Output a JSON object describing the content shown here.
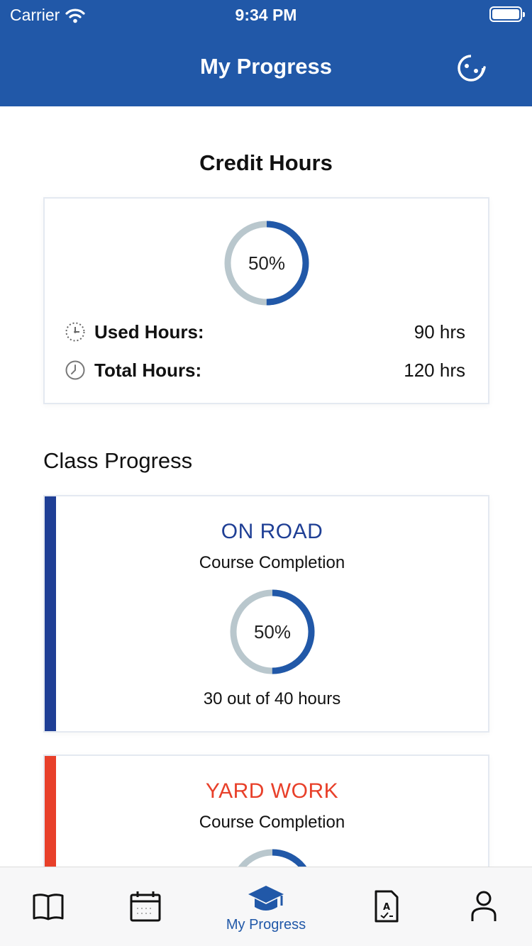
{
  "status_bar": {
    "carrier": "Carrier",
    "time": "9:34 PM"
  },
  "header": {
    "title": "My Progress",
    "help_icon": "support-icon"
  },
  "credit_hours": {
    "title": "Credit Hours",
    "percent_label": "50%",
    "percent": 0.5,
    "used_label": "Used Hours:",
    "used_value": "90 hrs",
    "total_label": "Total Hours:",
    "total_value": "120 hrs"
  },
  "class_progress": {
    "title": "Class Progress",
    "classes": [
      {
        "name": "ON ROAD",
        "subtitle": "Course Completion",
        "percent_label": "50%",
        "percent": 0.5,
        "hours": "30 out of 40 hours",
        "color": "#1f3f95"
      },
      {
        "name": "YARD WORK",
        "subtitle": "Course Completion",
        "percent": 0.5,
        "color": "#e8402a"
      }
    ]
  },
  "tabbar": {
    "tabs": [
      {
        "icon": "book-icon",
        "label": ""
      },
      {
        "icon": "calendar-icon",
        "label": ""
      },
      {
        "icon": "graduation-cap-icon",
        "label": "My Progress",
        "active": true
      },
      {
        "icon": "document-grade-icon",
        "label": ""
      },
      {
        "icon": "person-icon",
        "label": ""
      }
    ]
  },
  "colors": {
    "brand": "#2158a8",
    "ring_track": "#b9c7cd",
    "ring_fill": "#2158a8"
  }
}
